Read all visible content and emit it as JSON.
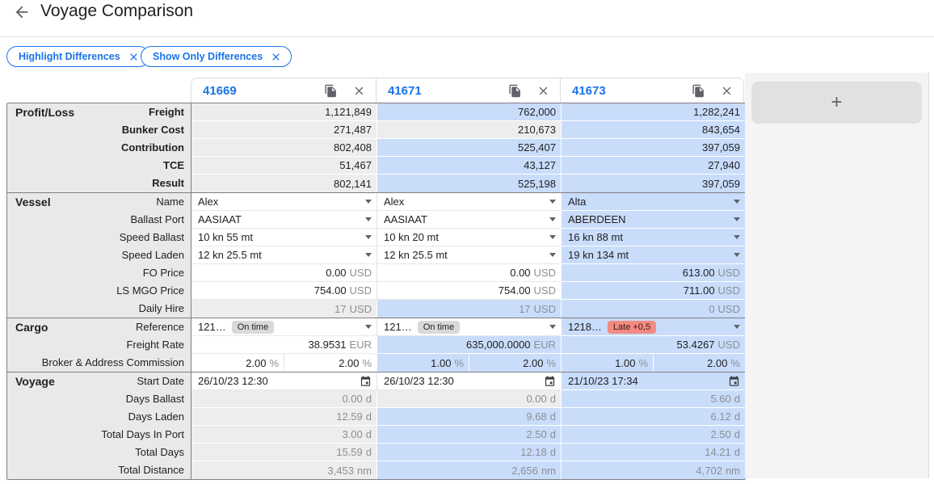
{
  "header": {
    "title": "Voyage Comparison"
  },
  "filters": [
    {
      "label": "Highlight Differences"
    },
    {
      "label": "Show Only Differences"
    }
  ],
  "columns": [
    "41669",
    "41671",
    "41673"
  ],
  "add_button_label": "+",
  "colors": {
    "accent-blue": "#1a73e8",
    "highlight-blue": "#c9dcfa",
    "cell-gray": "#ededed",
    "label-bg": "#e9e9e9",
    "dark-border": "#7f7f7f",
    "light-border": "#dadce0",
    "text-dark": "#202124",
    "text-muted": "#8a8f94",
    "icon-gray": "#5f6368",
    "panel-bg": "#f4f4f4",
    "button-gray": "#e1e1e1",
    "badge-gray": "#d9d9d9",
    "badge-red": "#f28b82"
  },
  "sections": [
    {
      "name": "Profit/Loss",
      "bold_labels": true,
      "rows": [
        {
          "label": "Freight",
          "kind": "number",
          "editable": false,
          "cells": [
            {
              "text": "1,121,849",
              "bg": "gray"
            },
            {
              "text": "762,000",
              "bg": "blue"
            },
            {
              "text": "1,282,241",
              "bg": "blue"
            }
          ]
        },
        {
          "label": "Bunker Cost",
          "kind": "number",
          "editable": false,
          "cells": [
            {
              "text": "271,487",
              "bg": "gray"
            },
            {
              "text": "210,673",
              "bg": "gray"
            },
            {
              "text": "843,654",
              "bg": "blue"
            }
          ]
        },
        {
          "label": "Contribution",
          "kind": "number",
          "editable": false,
          "cells": [
            {
              "text": "802,408",
              "bg": "gray"
            },
            {
              "text": "525,407",
              "bg": "blue"
            },
            {
              "text": "397,059",
              "bg": "blue"
            }
          ]
        },
        {
          "label": "TCE",
          "kind": "number",
          "editable": false,
          "cells": [
            {
              "text": "51,467",
              "bg": "gray"
            },
            {
              "text": "43,127",
              "bg": "blue"
            },
            {
              "text": "27,940",
              "bg": "blue"
            }
          ]
        },
        {
          "label": "Result",
          "kind": "number",
          "editable": false,
          "cells": [
            {
              "text": "802,141",
              "bg": "gray"
            },
            {
              "text": "525,198",
              "bg": "blue"
            },
            {
              "text": "397,059",
              "bg": "blue"
            }
          ]
        }
      ]
    },
    {
      "name": "Vessel",
      "bold_labels": false,
      "rows": [
        {
          "label": "Name",
          "kind": "dropdown",
          "editable": true,
          "cells": [
            {
              "text": "Alex",
              "bg": "white"
            },
            {
              "text": "Alex",
              "bg": "white"
            },
            {
              "text": "Alta",
              "bg": "blue"
            }
          ]
        },
        {
          "label": "Ballast Port",
          "kind": "dropdown",
          "editable": true,
          "cells": [
            {
              "text": "AASIAAT",
              "bg": "white"
            },
            {
              "text": "AASIAAT",
              "bg": "white"
            },
            {
              "text": "ABERDEEN",
              "bg": "blue"
            }
          ]
        },
        {
          "label": "Speed Ballast",
          "kind": "dropdown",
          "editable": true,
          "cells": [
            {
              "text": "10 kn 55 mt",
              "bg": "white"
            },
            {
              "text": "10 kn 20 mt",
              "bg": "white"
            },
            {
              "text": "16 kn 88 mt",
              "bg": "blue"
            }
          ]
        },
        {
          "label": "Speed Laden",
          "kind": "dropdown",
          "editable": true,
          "cells": [
            {
              "text": "12 kn 25.5 mt",
              "bg": "white"
            },
            {
              "text": "12 kn 25.5 mt",
              "bg": "white"
            },
            {
              "text": "19 kn 134 mt",
              "bg": "blue"
            }
          ]
        },
        {
          "label": "FO Price",
          "kind": "number",
          "editable": true,
          "cells": [
            {
              "text": "0.00",
              "unit": "USD",
              "bg": "white"
            },
            {
              "text": "0.00",
              "unit": "USD",
              "bg": "white"
            },
            {
              "text": "613.00",
              "unit": "USD",
              "bg": "blue"
            }
          ]
        },
        {
          "label": "LS MGO Price",
          "kind": "number",
          "editable": true,
          "cells": [
            {
              "text": "754.00",
              "unit": "USD",
              "bg": "white"
            },
            {
              "text": "754.00",
              "unit": "USD",
              "bg": "white"
            },
            {
              "text": "711.00",
              "unit": "USD",
              "bg": "blue"
            }
          ]
        },
        {
          "label": "Daily Hire",
          "kind": "number",
          "muted": true,
          "editable": false,
          "cells": [
            {
              "text": "17",
              "unit": "USD",
              "bg": "gray"
            },
            {
              "text": "17",
              "unit": "USD",
              "bg": "blue"
            },
            {
              "text": "0",
              "unit": "USD",
              "bg": "blue"
            }
          ]
        }
      ]
    },
    {
      "name": "Cargo",
      "bold_labels": false,
      "rows": [
        {
          "label": "Reference",
          "kind": "reference",
          "editable": true,
          "cells": [
            {
              "text": "121…",
              "badge": {
                "text": "On time",
                "type": "gray"
              },
              "bg": "white"
            },
            {
              "text": "121…",
              "badge": {
                "text": "On time",
                "type": "gray"
              },
              "bg": "white"
            },
            {
              "text": "1218…",
              "badge": {
                "text": "Late +0,5",
                "type": "red"
              },
              "bg": "blue"
            }
          ]
        },
        {
          "label": "Freight Rate",
          "kind": "number",
          "editable": true,
          "cells": [
            {
              "text": "38.9531",
              "unit": "EUR",
              "bg": "white"
            },
            {
              "text": "635,000.0000",
              "unit": "EUR",
              "bg": "blue"
            },
            {
              "text": "53.4267",
              "unit": "USD",
              "bg": "blue"
            }
          ]
        },
        {
          "label": "Broker & Address Commission",
          "kind": "split",
          "editable": true,
          "cells": [
            {
              "bg": "white",
              "parts": [
                {
                  "text": "2.00",
                  "unit": "%"
                },
                {
                  "text": "2.00",
                  "unit": "%"
                }
              ]
            },
            {
              "bg": "blue",
              "parts": [
                {
                  "text": "1.00",
                  "unit": "%"
                },
                {
                  "text": "2.00",
                  "unit": "%"
                }
              ]
            },
            {
              "bg": "blue",
              "parts": [
                {
                  "text": "1.00",
                  "unit": "%"
                },
                {
                  "text": "2.00",
                  "unit": "%"
                }
              ]
            }
          ]
        }
      ]
    },
    {
      "name": "Voyage",
      "bold_labels": false,
      "rows": [
        {
          "label": "Start Date",
          "kind": "date",
          "editable": true,
          "cells": [
            {
              "text": "26/10/23 12:30",
              "bg": "white"
            },
            {
              "text": "26/10/23 12:30",
              "bg": "white"
            },
            {
              "text": "21/10/23 17:34",
              "bg": "blue"
            }
          ]
        },
        {
          "label": "Days Ballast",
          "kind": "number",
          "muted": true,
          "editable": false,
          "cells": [
            {
              "text": "0.00",
              "unit": "d",
              "bg": "gray"
            },
            {
              "text": "0.00",
              "unit": "d",
              "bg": "gray"
            },
            {
              "text": "5.60",
              "unit": "d",
              "bg": "blue"
            }
          ]
        },
        {
          "label": "Days Laden",
          "kind": "number",
          "muted": true,
          "editable": false,
          "cells": [
            {
              "text": "12.59",
              "unit": "d",
              "bg": "gray"
            },
            {
              "text": "9.68",
              "unit": "d",
              "bg": "blue"
            },
            {
              "text": "6.12",
              "unit": "d",
              "bg": "blue"
            }
          ]
        },
        {
          "label": "Total Days In Port",
          "kind": "number",
          "muted": true,
          "editable": false,
          "cells": [
            {
              "text": "3.00",
              "unit": "d",
              "bg": "gray"
            },
            {
              "text": "2.50",
              "unit": "d",
              "bg": "blue"
            },
            {
              "text": "2.50",
              "unit": "d",
              "bg": "blue"
            }
          ]
        },
        {
          "label": "Total Days",
          "kind": "number",
          "muted": true,
          "editable": false,
          "cells": [
            {
              "text": "15.59",
              "unit": "d",
              "bg": "gray"
            },
            {
              "text": "12.18",
              "unit": "d",
              "bg": "blue"
            },
            {
              "text": "14.21",
              "unit": "d",
              "bg": "blue"
            }
          ]
        },
        {
          "label": "Total Distance",
          "kind": "number",
          "muted": true,
          "editable": false,
          "cells": [
            {
              "text": "3,453",
              "unit": "nm",
              "bg": "gray"
            },
            {
              "text": "2,656",
              "unit": "nm",
              "bg": "blue"
            },
            {
              "text": "4,702",
              "unit": "nm",
              "bg": "blue"
            }
          ]
        }
      ]
    }
  ]
}
